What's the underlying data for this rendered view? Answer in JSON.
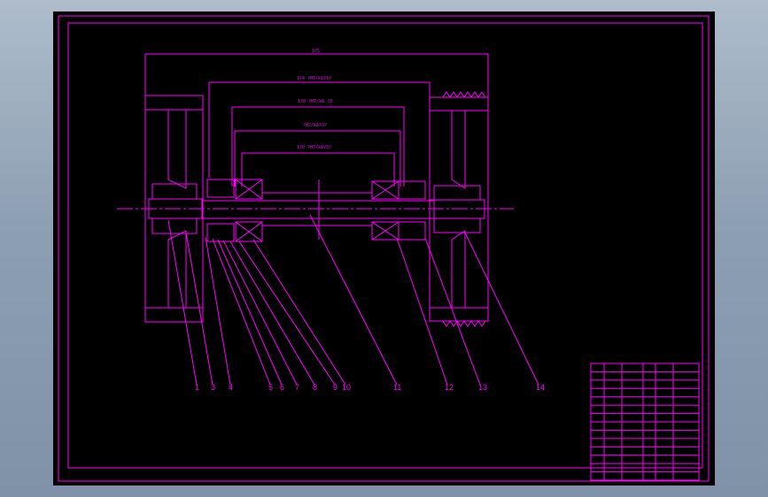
{
  "colors": {
    "line": "#ff00ff",
    "canvas": "#000000",
    "chrome": "#9aaabc"
  },
  "dimensions": [
    {
      "text": "3?5"
    },
    {
      "text": "1?4 ?H7/k6?3?"
    },
    {
      "text": "1?0 ?H7/k6 ?3"
    },
    {
      "text": "?H7/k6?3?"
    },
    {
      "text": "1?0 ?H7/k6?3?"
    }
  ],
  "part_labels": [
    "1",
    "3",
    "4",
    "5",
    "6",
    "7",
    "8",
    "9",
    "10",
    "11",
    "12",
    "13",
    "14"
  ],
  "title_block": {
    "rows": 14,
    "cols": 6
  }
}
